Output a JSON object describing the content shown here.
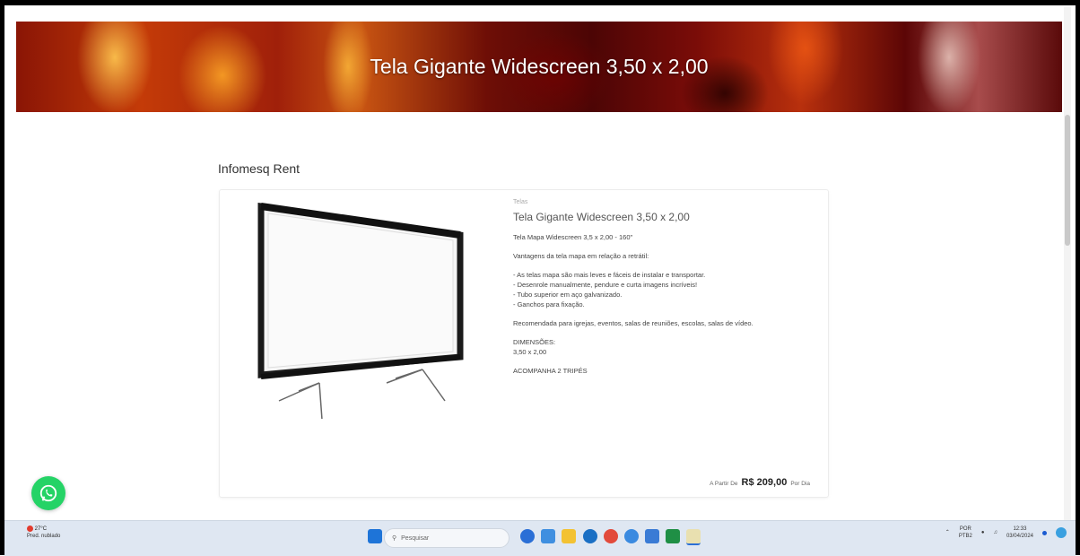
{
  "hero": {
    "title": "Tela Gigante Widescreen 3,50 x 2,00"
  },
  "store": {
    "name": "Infomesq Rent"
  },
  "product": {
    "category": "Telas",
    "title": "Tela Gigante Widescreen 3,50 x 2,00",
    "subtitle": "Tela Mapa Widescreen 3,5 x 2,00 - 160\"",
    "advantages_heading": "Vantagens da tela mapa em relação a retrátil:",
    "advantages": [
      "- As telas mapa são mais leves e fáceis de instalar e transportar.",
      "- Desenrole manualmente, pendure e curta imagens incríveis!",
      "- Tubo superior em aço galvanizado.",
      "- Ganchos para fixação."
    ],
    "recommended": "Recomendada para igrejas, eventos, salas de reuniões, escolas, salas de vídeo.",
    "dimensions_label": "DIMENSÕES:",
    "dimensions_value": "3,50 x 2,00",
    "accessory": "ACOMPANHA 2 TRIPÉS",
    "price_prefix": "A Partir De",
    "price": "R$ 209,00",
    "price_suffix": "Por Dia"
  },
  "taskbar": {
    "weather_temp": "27°C",
    "weather_desc": "Pred. nublado",
    "search_placeholder": "Pesquisar",
    "lang_top": "POR",
    "lang_bottom": "PTB2",
    "time": "12:33",
    "date": "03/04/2024"
  },
  "colors": {
    "accent_whatsapp": "#25d366",
    "price_text": "#222222"
  }
}
